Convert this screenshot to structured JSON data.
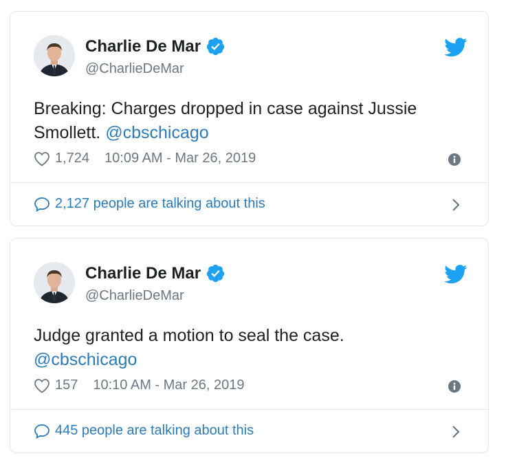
{
  "tweets": [
    {
      "author_name": "Charlie De Mar",
      "handle": "@CharlieDeMar",
      "text_line1": "Breaking: Charges dropped in case against Jussie",
      "text_line2_pre": "Smollett. ",
      "mention": "@cbschicago",
      "likes": "1,724",
      "timestamp": "10:09 AM - Mar 26, 2019",
      "talking": "2,127 people are talking about this",
      "icons": [
        "verified-badge-icon",
        "twitter-bird-icon",
        "heart-icon",
        "info-icon",
        "comment-bubble-icon",
        "chevron-right-icon"
      ]
    },
    {
      "author_name": "Charlie De Mar",
      "handle": "@CharlieDeMar",
      "text_line1": "Judge granted a motion to seal the case.",
      "text_line2_pre": "",
      "mention": "@cbschicago",
      "likes": "157",
      "timestamp": "10:10 AM - Mar 26, 2019",
      "talking": "445 people are talking about this",
      "icons": [
        "verified-badge-icon",
        "twitter-bird-icon",
        "heart-icon",
        "info-icon",
        "comment-bubble-icon",
        "chevron-right-icon"
      ]
    }
  ],
  "colors": {
    "link": "#2b7bb9",
    "muted": "#697882",
    "text": "#1c2022",
    "twitter_blue": "#1da1f2",
    "border": "#e1e8ed"
  }
}
